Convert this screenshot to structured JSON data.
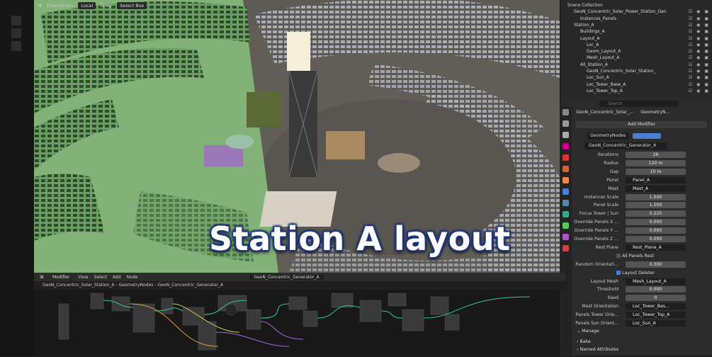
{
  "viewport_header": {
    "orientation_label": "Orientation:",
    "orientation_value": "Local",
    "drag_label": "Drag:",
    "drag_value": "Select Box"
  },
  "overlay_title": "Station A layout",
  "outliner": {
    "rows": [
      {
        "label": "Scene Collection",
        "indent": 0
      },
      {
        "label": "GeoN_Concentric_Solar_Power_Station_Gen",
        "indent": 1
      },
      {
        "label": "Instances_Panels",
        "indent": 2
      },
      {
        "label": "Station_A",
        "indent": 1
      },
      {
        "label": "Buildings_A",
        "indent": 2
      },
      {
        "label": "Layout_A",
        "indent": 2
      },
      {
        "label": "Loc_A",
        "indent": 3
      },
      {
        "label": "Geom_Layout_A",
        "indent": 3
      },
      {
        "label": "Mesh_Layout_A",
        "indent": 3
      },
      {
        "label": "All_Station_A",
        "indent": 2
      },
      {
        "label": "GeoN_Concentric_Solar_Station_",
        "indent": 3
      },
      {
        "label": "Loc_Sun_A",
        "indent": 3
      },
      {
        "label": "Loc_Tower_Base_A",
        "indent": 3
      },
      {
        "label": "Loc_Tower_Top_A",
        "indent": 3
      }
    ]
  },
  "properties": {
    "search_placeholder": "Search",
    "object_name": "GeoN_Concentric_Solar_...",
    "object_name2": "GeometryN...",
    "add_modifier": "Add Modifier",
    "modifier_name": "GeometryNodes",
    "node_group": "GeoN_Concentric_Generator_A",
    "fields": [
      {
        "label": "Iterations",
        "value": "26",
        "type": "num"
      },
      {
        "label": "Radius",
        "value": "120 m",
        "type": "num"
      },
      {
        "label": "Gap",
        "value": "10 m",
        "type": "num"
      },
      {
        "label": "Panel",
        "value": "Panel_A",
        "type": "obj"
      },
      {
        "label": "Mast",
        "value": "Mast_A",
        "type": "obj"
      },
      {
        "label": "Instances Scale",
        "value": "1.000",
        "type": "num"
      },
      {
        "label": "Panel Scale",
        "value": "1.200",
        "type": "num"
      },
      {
        "label": "Focus Tower | Sun",
        "value": "0.225",
        "type": "num"
      },
      {
        "label": "Override Panels X ...",
        "value": "0.000",
        "type": "num"
      },
      {
        "label": "Override Panels Y ...",
        "value": "0.000",
        "type": "num"
      },
      {
        "label": "Override Panels Z ...",
        "value": "0.000",
        "type": "num"
      },
      {
        "label": "Rest Plane",
        "value": "Rest_Plane_A",
        "type": "obj"
      },
      {
        "label": "",
        "value": "All Panels Rest",
        "type": "check",
        "checked": false
      },
      {
        "label": "Random Orientati...",
        "value": "0.300",
        "type": "num"
      },
      {
        "label": "",
        "value": "Layout Deleter",
        "type": "check",
        "checked": true
      },
      {
        "label": "Layout Mesh",
        "value": "Mesh_Layout_A",
        "type": "obj"
      },
      {
        "label": "Threshold",
        "value": "0.000",
        "type": "num"
      },
      {
        "label": "Seed",
        "value": "0",
        "type": "num"
      },
      {
        "label": "Mast Orientation",
        "value": "Loc_Tower_Bas...",
        "type": "obj"
      },
      {
        "label": "Panels Tower Orie...",
        "value": "Loc_Tower_Top_A",
        "type": "obj"
      },
      {
        "label": "Panels Sun Orient...",
        "value": "Loc_Sun_A",
        "type": "obj"
      }
    ],
    "sections": [
      "Manage",
      "Bake",
      "Named Attributes"
    ]
  },
  "node_editor": {
    "menu": [
      "Modifier",
      "View",
      "Select",
      "Add",
      "Node"
    ],
    "tree_name": "GeoN_Concentric_Generator_A",
    "breadcrumb": [
      "GeoN_Concentric_Solar_Station_A",
      "GeometryNodes",
      "GeoN_Concentric_Generator_A"
    ]
  }
}
